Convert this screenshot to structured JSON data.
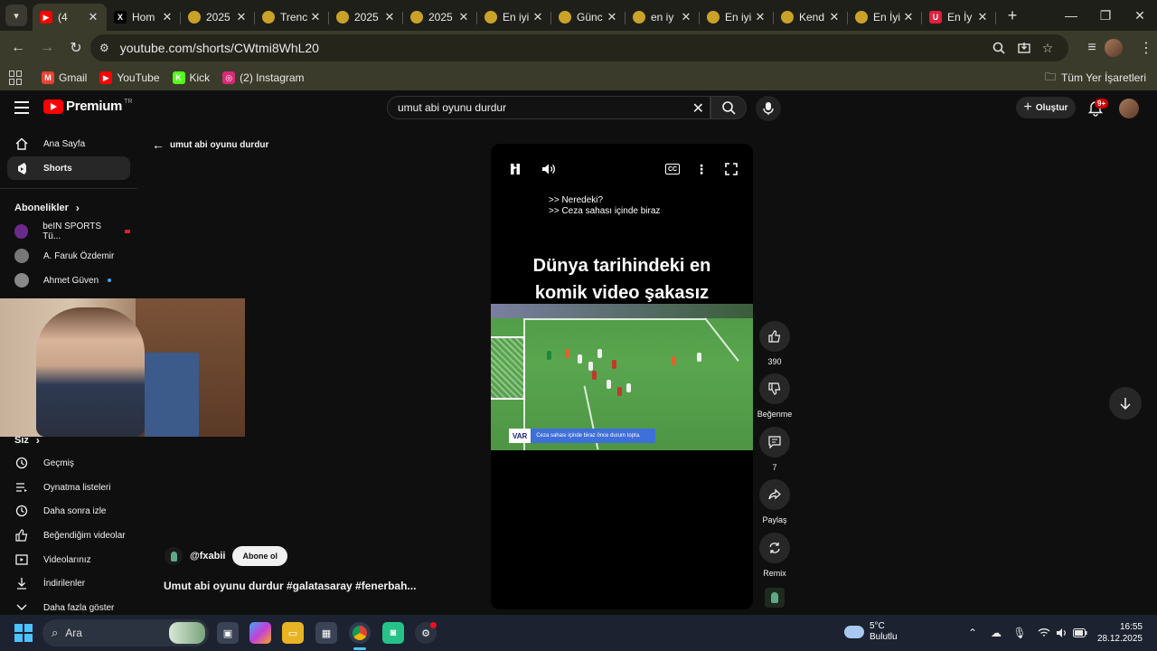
{
  "browser": {
    "tabs": [
      {
        "title": "(4",
        "favicon": "youtube",
        "color": "#ff0000",
        "glyph": "▶",
        "active": true
      },
      {
        "title": "Hom",
        "favicon": "x",
        "color": "#000000",
        "glyph": "X",
        "active": false
      },
      {
        "title": "2025",
        "favicon": "generic",
        "color": "#c9a227",
        "glyph": "",
        "active": false
      },
      {
        "title": "Trenc",
        "favicon": "generic",
        "color": "#c9a227",
        "glyph": "",
        "active": false
      },
      {
        "title": "2025",
        "favicon": "generic",
        "color": "#c9a227",
        "glyph": "",
        "active": false
      },
      {
        "title": "2025",
        "favicon": "generic",
        "color": "#c9a227",
        "glyph": "",
        "active": false
      },
      {
        "title": "En iyi",
        "favicon": "generic",
        "color": "#c9a227",
        "glyph": "",
        "active": false
      },
      {
        "title": "Günc",
        "favicon": "generic",
        "color": "#c9a227",
        "glyph": "",
        "active": false
      },
      {
        "title": "en iy",
        "favicon": "generic",
        "color": "#c9a227",
        "glyph": "",
        "active": false
      },
      {
        "title": "En iyi",
        "favicon": "generic",
        "color": "#c9a227",
        "glyph": "",
        "active": false
      },
      {
        "title": "Kend",
        "favicon": "generic",
        "color": "#c9a227",
        "glyph": "",
        "active": false
      },
      {
        "title": "En İyi",
        "favicon": "generic",
        "color": "#c9a227",
        "glyph": "",
        "active": false
      },
      {
        "title": "En İy",
        "favicon": "udemy",
        "color": "#e0203b",
        "glyph": "U",
        "active": false
      }
    ],
    "url": "youtube.com/shorts/CWtmi8WhL20",
    "bookmarks": [
      {
        "label": "Gmail",
        "color": "#ea4335",
        "glyph": "M"
      },
      {
        "label": "YouTube",
        "color": "#ff0000",
        "glyph": "▶"
      },
      {
        "label": "Kick",
        "color": "#53fc18",
        "glyph": "K"
      },
      {
        "label": "(2) Instagram",
        "color": "#d62976",
        "glyph": "◎"
      }
    ],
    "all_bookmarks": "Tüm Yer İşaretleri"
  },
  "youtube": {
    "logo": "Premium",
    "logo_region": "TR",
    "search_value": "umut abi oyunu durdur",
    "create_label": "Oluştur",
    "notifications_badge": "9+",
    "sidebar": {
      "home": "Ana Sayfa",
      "shorts": "Shorts",
      "subscriptions_header": "Abonelikler",
      "subscriptions": [
        "beIN SPORTS Tü...",
        "A. Faruk Özdemir",
        "Ahmet Güven"
      ],
      "you_header": "Siz",
      "you_items": [
        "Geçmiş",
        "Oynatma listeleri",
        "Daha sonra izle",
        "Beğendiğim videolar",
        "Videolarınız",
        "İndirilenler",
        "Daha fazla göster"
      ]
    },
    "back_label": "umut abi oyunu durdur",
    "player": {
      "subtitle_lines": [
        ">> Neredeki?",
        ">> Ceza sahası içinde biraz"
      ],
      "headline_1": "Dünya tarihindeki en",
      "headline_2": "komik video şakasız",
      "var_tag": "VAR",
      "var_text": "Ceza sahası içinde biraz önce durum topta."
    },
    "actions": {
      "likes": "390",
      "dislike_label": "Beğenme",
      "comments": "7",
      "share_label": "Paylaş",
      "remix_label": "Remix"
    },
    "channel": "@fxabii",
    "subscribe_label": "Abone ol",
    "video_title": "Umut abi oyunu durdur #galatasaray #fenerbah..."
  },
  "taskbar": {
    "search_placeholder": "Ara",
    "weather_temp": "5°C",
    "weather_desc": "Bulutlu",
    "time": "16:55",
    "date": "28.12.2025"
  }
}
